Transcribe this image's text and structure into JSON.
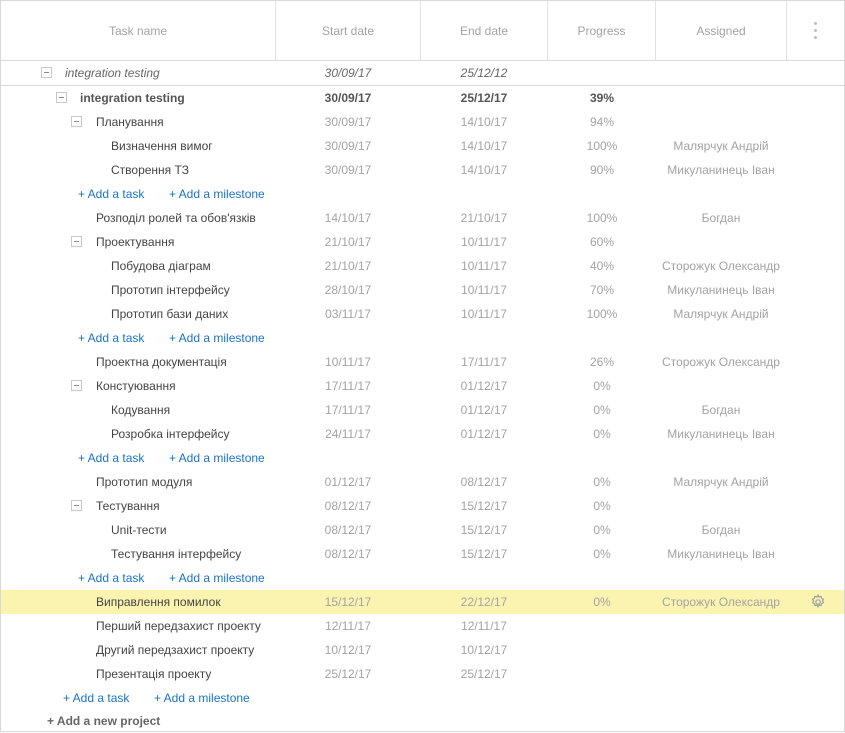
{
  "header": {
    "task_name": "Task name",
    "start_date": "Start date",
    "end_date": "End date",
    "progress": "Progress",
    "assigned": "Assigned"
  },
  "project": {
    "name": "integration testing",
    "start": "30/09/17",
    "end": "25/12/12"
  },
  "rows": [
    {
      "kind": "group",
      "level": 0,
      "bold": true,
      "name": "integration testing",
      "start": "30/09/17",
      "end": "25/12/17",
      "progress": "39%",
      "assigned": ""
    },
    {
      "kind": "group",
      "level": 1,
      "name": "Планування",
      "start": "30/09/17",
      "end": "14/10/17",
      "progress": "94%",
      "assigned": ""
    },
    {
      "kind": "task",
      "level": 2,
      "name": "Визначення вимог",
      "start": "30/09/17",
      "end": "14/10/17",
      "progress": "100%",
      "assigned": "Малярчук Андрій"
    },
    {
      "kind": "task",
      "level": 2,
      "name": "Створення ТЗ",
      "start": "30/09/17",
      "end": "14/10/17",
      "progress": "90%",
      "assigned": "Микуланинець Іван"
    },
    {
      "kind": "add",
      "level": 2,
      "add_task": "+ Add a task",
      "add_milestone": "+ Add a milestone"
    },
    {
      "kind": "task",
      "level": 1,
      "name": "Розподіл ролей та обов'язків",
      "start": "14/10/17",
      "end": "21/10/17",
      "progress": "100%",
      "assigned": "Богдан"
    },
    {
      "kind": "group",
      "level": 1,
      "name": "Проектування",
      "start": "21/10/17",
      "end": "10/11/17",
      "progress": "60%",
      "assigned": ""
    },
    {
      "kind": "task",
      "level": 2,
      "name": "Побудова діаграм",
      "start": "21/10/17",
      "end": "10/11/17",
      "progress": "40%",
      "assigned": "Сторожук Олександр"
    },
    {
      "kind": "task",
      "level": 2,
      "name": "Прототип інтерфейсу",
      "start": "28/10/17",
      "end": "10/11/17",
      "progress": "70%",
      "assigned": "Микуланинець Іван"
    },
    {
      "kind": "task",
      "level": 2,
      "name": "Прототип бази даних",
      "start": "03/11/17",
      "end": "10/11/17",
      "progress": "100%",
      "assigned": "Малярчук Андрій"
    },
    {
      "kind": "add",
      "level": 2,
      "add_task": "+ Add a task",
      "add_milestone": "+ Add a milestone"
    },
    {
      "kind": "task",
      "level": 1,
      "name": "Проектна документація",
      "start": "10/11/17",
      "end": "17/11/17",
      "progress": "26%",
      "assigned": "Сторожук Олександр"
    },
    {
      "kind": "group",
      "level": 1,
      "name": "Констуювання",
      "start": "17/11/17",
      "end": "01/12/17",
      "progress": "0%",
      "assigned": ""
    },
    {
      "kind": "task",
      "level": 2,
      "name": "Кодування",
      "start": "17/11/17",
      "end": "01/12/17",
      "progress": "0%",
      "assigned": "Богдан"
    },
    {
      "kind": "task",
      "level": 2,
      "name": "Розробка інтерфейсу",
      "start": "24/11/17",
      "end": "01/12/17",
      "progress": "0%",
      "assigned": "Микуланинець Іван"
    },
    {
      "kind": "add",
      "level": 2,
      "add_task": "+ Add a task",
      "add_milestone": "+ Add a milestone"
    },
    {
      "kind": "task",
      "level": 1,
      "name": "Прототип модуля",
      "start": "01/12/17",
      "end": "08/12/17",
      "progress": "0%",
      "assigned": "Малярчук Андрій"
    },
    {
      "kind": "group",
      "level": 1,
      "name": "Тестування",
      "start": "08/12/17",
      "end": "15/12/17",
      "progress": "0%",
      "assigned": ""
    },
    {
      "kind": "task",
      "level": 2,
      "name": "Unit-тести",
      "start": "08/12/17",
      "end": "15/12/17",
      "progress": "0%",
      "assigned": "Богдан"
    },
    {
      "kind": "task",
      "level": 2,
      "name": "Тестування інтерфейсу",
      "start": "08/12/17",
      "end": "15/12/17",
      "progress": "0%",
      "assigned": "Микуланинець Іван"
    },
    {
      "kind": "add",
      "level": 2,
      "add_task": "+ Add a task",
      "add_milestone": "+ Add a milestone"
    },
    {
      "kind": "task",
      "level": 1,
      "selected": true,
      "name": "Виправлення помилок",
      "start": "15/12/17",
      "end": "22/12/17",
      "progress": "0%",
      "assigned": "Сторожук Олександр"
    },
    {
      "kind": "task",
      "level": 1,
      "name": "Перший передзахист проекту",
      "start": "12/11/17",
      "end": "12/11/17",
      "progress": "",
      "assigned": ""
    },
    {
      "kind": "task",
      "level": 1,
      "name": "Другий передзахист проекту",
      "start": "10/12/17",
      "end": "10/12/17",
      "progress": "",
      "assigned": ""
    },
    {
      "kind": "task",
      "level": 1,
      "name": "Презентація проекту",
      "start": "25/12/17",
      "end": "25/12/17",
      "progress": "",
      "assigned": ""
    },
    {
      "kind": "add",
      "level": 1,
      "add_task": "+ Add a task",
      "add_milestone": "+ Add a milestone"
    }
  ],
  "add_project": "+ Add a new project",
  "colors": {
    "selected_row": "#fbf3b0",
    "link": "#1a73c5",
    "muted_text": "#a3a3a3",
    "border": "#d9d9d9"
  },
  "icons": {
    "collapse": "minus-square-icon",
    "settings": "gear-icon",
    "menu": "vertical-dots-icon"
  }
}
